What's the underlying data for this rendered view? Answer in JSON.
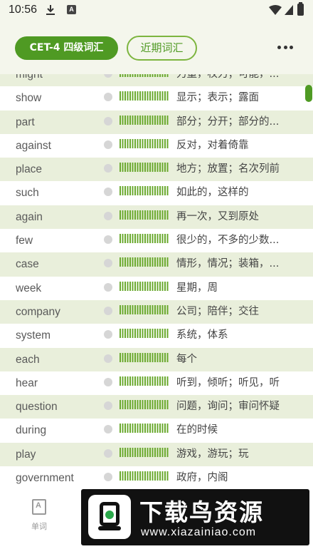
{
  "status_bar": {
    "time": "10:56",
    "icon_a": "A"
  },
  "header": {
    "tab_active": "CET-4 四级词汇",
    "tab_inactive": "近期词汇",
    "more_icon": "more-dots-icon"
  },
  "words": [
    {
      "word": "might",
      "meaning": "力量，权力；可能，..."
    },
    {
      "word": "show",
      "meaning": "显示；表示；露面"
    },
    {
      "word": "part",
      "meaning": "部分；分开；部分的..."
    },
    {
      "word": "against",
      "meaning": "反对，对着倚靠"
    },
    {
      "word": "place",
      "meaning": "地方；放置；名次列前"
    },
    {
      "word": "such",
      "meaning": "如此的，这样的"
    },
    {
      "word": "again",
      "meaning": "再一次，又到原处"
    },
    {
      "word": "few",
      "meaning": "很少的，不多的少数..."
    },
    {
      "word": "case",
      "meaning": "情形，情况；装箱，..."
    },
    {
      "word": "week",
      "meaning": "星期，周"
    },
    {
      "word": "company",
      "meaning": "公司；陪伴；交往"
    },
    {
      "word": "system",
      "meaning": "系统，体系"
    },
    {
      "word": "each",
      "meaning": "每个"
    },
    {
      "word": "hear",
      "meaning": "听到，倾听；听见，听"
    },
    {
      "word": "question",
      "meaning": "问题，询问；审问怀疑"
    },
    {
      "word": "during",
      "meaning": "在的时候"
    },
    {
      "word": "play",
      "meaning": "游戏，游玩；玩"
    },
    {
      "word": "government",
      "meaning": "政府，内阁"
    }
  ],
  "bottom_nav": {
    "word_tab_label": "单词"
  },
  "watermark": {
    "title": "下载鸟资源",
    "url": "www.xiazainiao.com"
  },
  "colors": {
    "accent": "#4f9a23",
    "row_alt": "#e9efdb",
    "background": "#f4f6ec"
  }
}
